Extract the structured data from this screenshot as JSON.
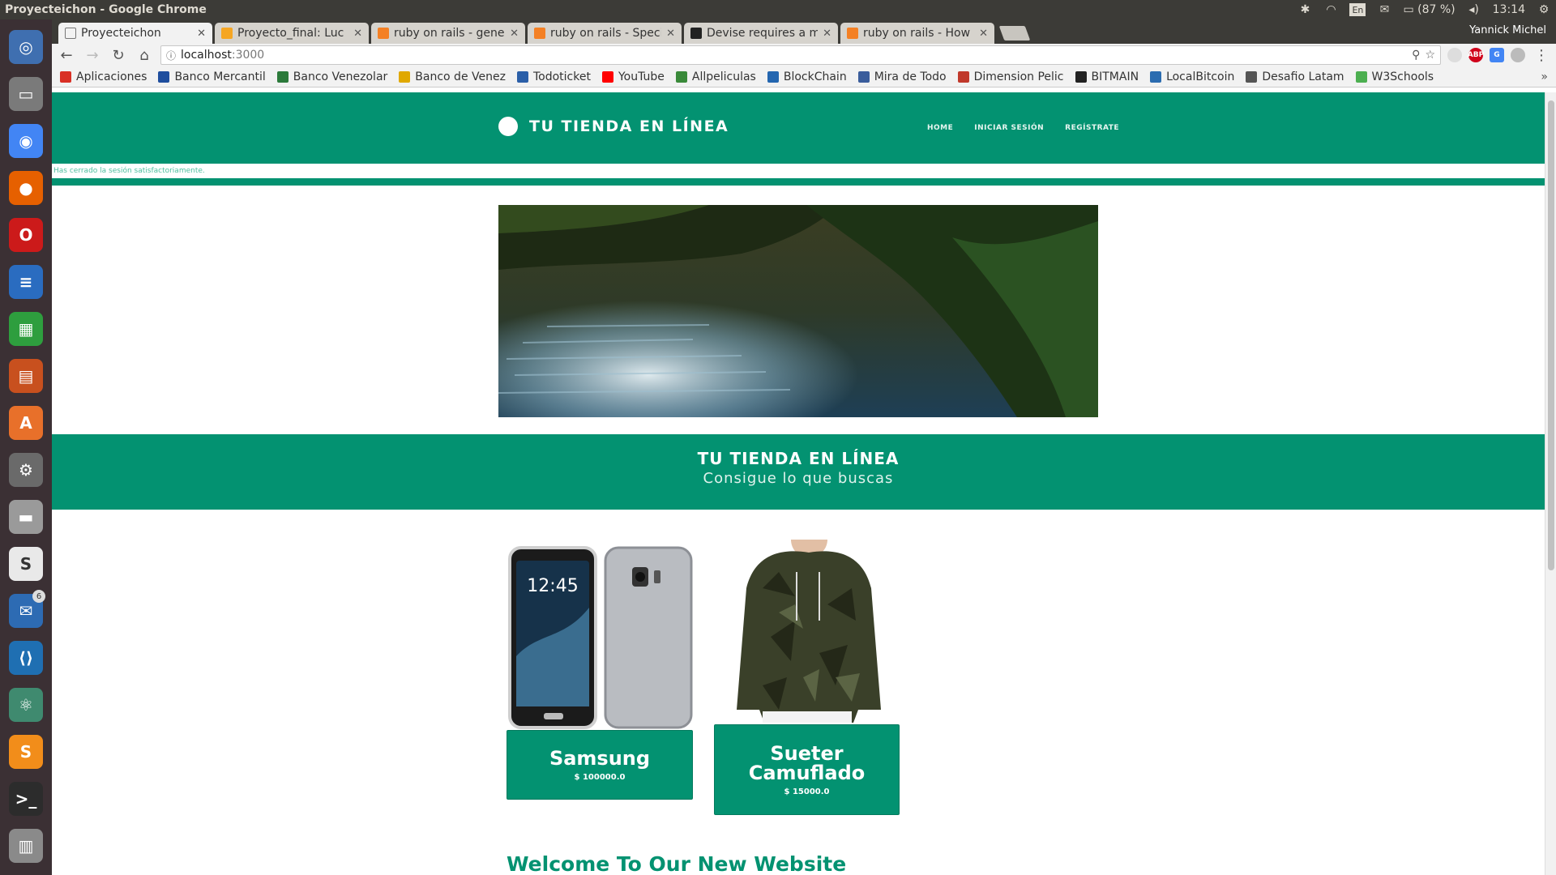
{
  "os": {
    "window_title": "Proyecteichon - Google Chrome",
    "battery": "(87 %)",
    "clock": "13:14",
    "keyboard": "En"
  },
  "launcher": {
    "items": [
      {
        "name": "ubuntu-dash",
        "color": "#3f6fb0",
        "glyph": "◎"
      },
      {
        "name": "files",
        "color": "#7a7a7a",
        "glyph": "▭"
      },
      {
        "name": "chrome",
        "color": "#4285f4",
        "glyph": "◉"
      },
      {
        "name": "firefox",
        "color": "#e66000",
        "glyph": "●"
      },
      {
        "name": "opera",
        "color": "#cc1a1a",
        "glyph": "O"
      },
      {
        "name": "writer",
        "color": "#2a6cc0",
        "glyph": "≡"
      },
      {
        "name": "calc",
        "color": "#2e9e3e",
        "glyph": "▦"
      },
      {
        "name": "impress",
        "color": "#c8501e",
        "glyph": "▤"
      },
      {
        "name": "software-center",
        "color": "#e8702a",
        "glyph": "A"
      },
      {
        "name": "settings",
        "color": "#6a6a6a",
        "glyph": "⚙"
      },
      {
        "name": "disk",
        "color": "#9a9a9a",
        "glyph": "▬"
      },
      {
        "name": "slack",
        "color": "#e9e9e9",
        "glyph": "S"
      },
      {
        "name": "thunderbird",
        "color": "#2d6bb3",
        "glyph": "✉",
        "badge": "6"
      },
      {
        "name": "vscode",
        "color": "#1f6fb2",
        "glyph": "⟨⟩"
      },
      {
        "name": "atom",
        "color": "#3f8a6f",
        "glyph": "⚛"
      },
      {
        "name": "sublime",
        "color": "#f28d1a",
        "glyph": "S"
      },
      {
        "name": "terminal",
        "color": "#2c2c2c",
        "glyph": ">_"
      },
      {
        "name": "trash",
        "color": "#8a8a8a",
        "glyph": "▥"
      }
    ]
  },
  "browser": {
    "profile": "Yannick Michel",
    "tabs": [
      {
        "title": "Proyecteichon",
        "icon_color": "#ffffff",
        "active": true
      },
      {
        "title": "Proyecto_final: Luc",
        "icon_color": "#f5a623"
      },
      {
        "title": "ruby on rails - gene",
        "icon_color": "#f48024"
      },
      {
        "title": "ruby on rails - Speci",
        "icon_color": "#f48024"
      },
      {
        "title": "Devise requires a m",
        "icon_color": "#222222"
      },
      {
        "title": "ruby on rails - How",
        "icon_color": "#f48024"
      }
    ],
    "url_host": "localhost",
    "url_port": ":3000",
    "bookmarks": [
      {
        "label": "Aplicaciones",
        "color": "#d93025"
      },
      {
        "label": "Banco Mercantil",
        "color": "#1f4e9e"
      },
      {
        "label": "Banco Venezolar",
        "color": "#2c7a3b"
      },
      {
        "label": "Banco de Venez",
        "color": "#e0a800"
      },
      {
        "label": "Todoticket",
        "color": "#2b5fa8"
      },
      {
        "label": "YouTube",
        "color": "#ff0000"
      },
      {
        "label": "Allpeliculas",
        "color": "#3a8a3a"
      },
      {
        "label": "BlockChain",
        "color": "#2466b0"
      },
      {
        "label": "Mira de Todo",
        "color": "#3a5d9c"
      },
      {
        "label": "Dimension Pelic",
        "color": "#c0392b"
      },
      {
        "label": "BITMAIN",
        "color": "#222222"
      },
      {
        "label": "LocalBitcoin",
        "color": "#2b6cb0"
      },
      {
        "label": "Desafio Latam",
        "color": "#555555"
      },
      {
        "label": "W3Schools",
        "color": "#4caf50"
      }
    ]
  },
  "site": {
    "brand": "TU TIENDA EN LÍNEA",
    "nav": [
      "HOME",
      "INICIAR SESIÓN",
      "REGÍSTRATE"
    ],
    "flash": "Has cerrado la sesión satisfactoriamente.",
    "banner_title": "TU TIENDA EN LÍNEA",
    "banner_subtitle": "Consigue lo que buscas",
    "products": [
      {
        "name": "Samsung",
        "price": "$ 100000.0"
      },
      {
        "name": "Sueter Camuflado",
        "price": "$ 15000.0"
      }
    ],
    "welcome": "Welcome To Our New Website",
    "accent": "#039271"
  }
}
